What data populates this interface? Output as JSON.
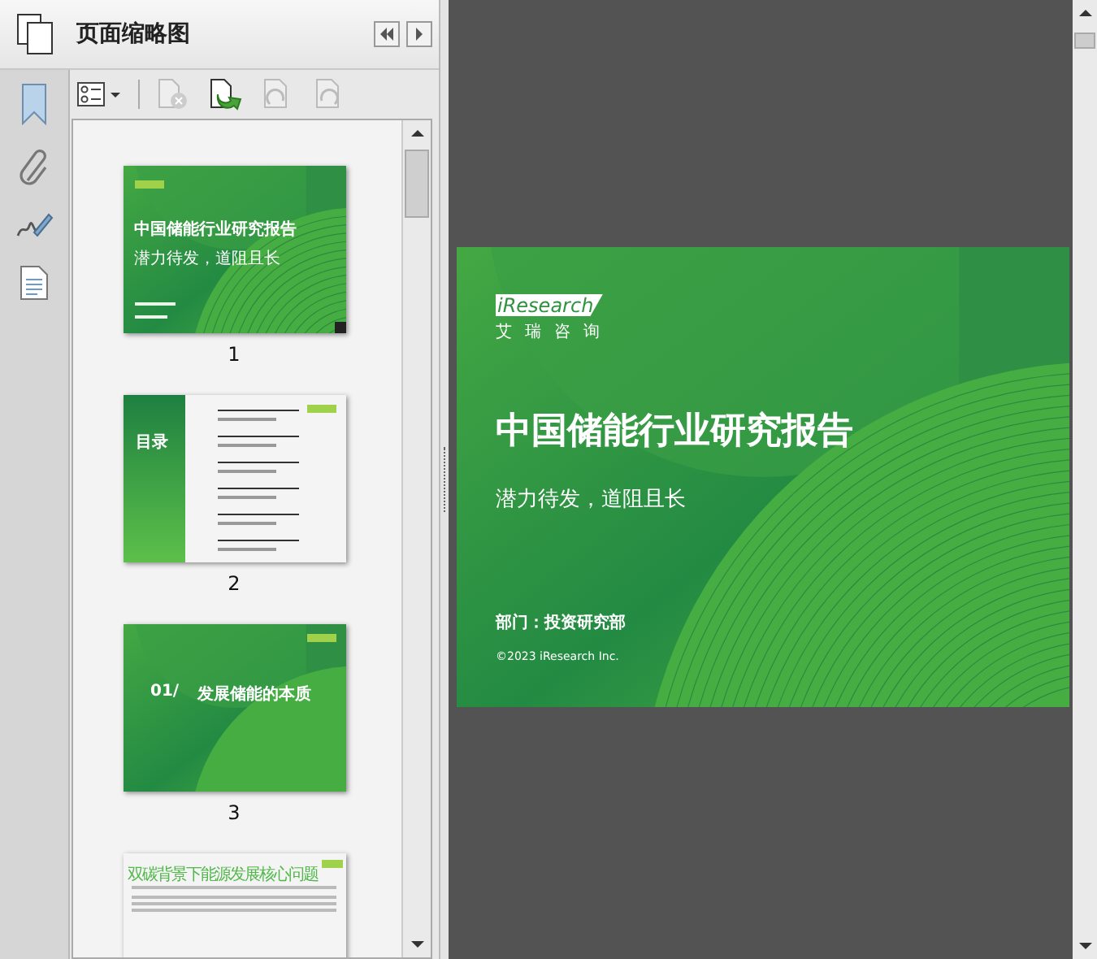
{
  "panel": {
    "title": "页面缩略图"
  },
  "thumbnails": [
    {
      "page": "1",
      "kind": "cover",
      "selected": true,
      "title": "中国储能行业研究报告",
      "subtitle": "潜力待发，道阻且长"
    },
    {
      "page": "2",
      "kind": "contents",
      "selected": false,
      "heading": "目录"
    },
    {
      "page": "3",
      "kind": "section",
      "selected": false,
      "number": "01/",
      "title": "发展储能的本质"
    },
    {
      "kind": "text",
      "selected": false,
      "title": "双碳背景下能源发展核心问题"
    }
  ],
  "slide": {
    "logo": "iResearch",
    "logo_caption": "艾瑞咨询",
    "title": "中国储能行业研究报告",
    "subtitle": "潜力待发，道阻且长",
    "department": "部门：投资研究部",
    "copyright": "©2023 iResearch Inc."
  }
}
